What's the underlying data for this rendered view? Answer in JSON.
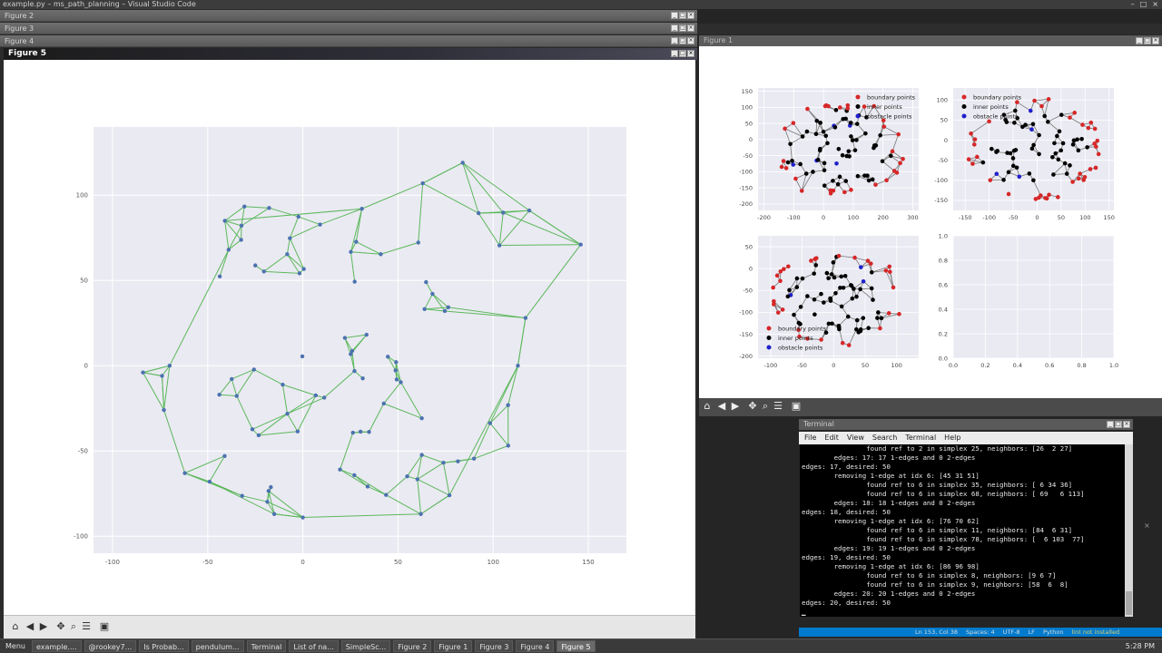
{
  "vscode": {
    "title": "example.py – ms_path_planning – Visual Studio Code",
    "status": {
      "position": "Ln 153, Col 38",
      "spaces": "Spaces: 4",
      "encoding": "UTF-8",
      "eol": "LF",
      "language": "Python",
      "lint": "lint not installed"
    }
  },
  "figures_stack": [
    "Figure 2",
    "Figure 3",
    "Figure 4"
  ],
  "figure5": {
    "title": "Figure 5",
    "chart_data": {
      "type": "scatter",
      "x_ticks": [
        "-100",
        "-50",
        "0",
        "50",
        "100",
        "150"
      ],
      "y_ticks": [
        "100",
        "50",
        "0",
        "-50",
        "-100"
      ],
      "xlim": [
        -110,
        170
      ],
      "ylim": [
        -110,
        140
      ],
      "grid": true,
      "colors": {
        "edge": "#5cb85c",
        "node": "#4c72b0",
        "bg": "#eaeaf2"
      }
    }
  },
  "figure1": {
    "title": "Figure 1",
    "legend": [
      "boundary points",
      "inner points",
      "obstacle points"
    ],
    "subplots": [
      {
        "x_ticks": [
          "-200",
          "-100",
          "0",
          "100",
          "200",
          "300"
        ],
        "y_ticks": [
          "150",
          "100",
          "50",
          "0",
          "-50",
          "-100",
          "-150",
          "-200"
        ]
      },
      {
        "x_ticks": [
          "-150",
          "-100",
          "-50",
          "0",
          "50",
          "100",
          "150"
        ],
        "y_ticks": [
          "100",
          "50",
          "0",
          "-50",
          "-100",
          "-150"
        ]
      },
      {
        "x_ticks": [
          "-100",
          "-50",
          "0",
          "50",
          "100"
        ],
        "y_ticks": [
          "50",
          "0",
          "-50",
          "-100",
          "-150",
          "-200"
        ]
      },
      {
        "x_ticks": [
          "0.0",
          "0.2",
          "0.4",
          "0.6",
          "0.8",
          "1.0"
        ],
        "y_ticks": [
          "1.0",
          "0.8",
          "0.6",
          "0.4",
          "0.2",
          "0.0"
        ]
      }
    ],
    "colors": {
      "boundary": "#d62728",
      "inner": "#000000",
      "obstacle": "#1f1fcc",
      "edge": "#777777"
    }
  },
  "terminal": {
    "title": "Terminal",
    "menu": [
      "File",
      "Edit",
      "View",
      "Search",
      "Terminal",
      "Help"
    ],
    "lines": [
      "                found ref to 2 in simplex 25, neighbors: [26  2 27]",
      "        edges: 17: 17 1-edges and 0 2-edges",
      "edges: 17, desired: 50",
      "        removing 1-edge at idx 6: [45 31 51]",
      "                found ref to 6 in simplex 35, neighbors: [ 6 34 36]",
      "                found ref to 6 in simplex 68, neighbors: [ 69   6 113]",
      "        edges: 18: 18 1-edges and 0 2-edges",
      "edges: 18, desired: 50",
      "        removing 1-edge at idx 6: [76 70 62]",
      "                found ref to 6 in simplex 11, neighbors: [84  6 31]",
      "                found ref to 6 in simplex 78, neighbors: [  6 103  77]",
      "        edges: 19: 19 1-edges and 0 2-edges",
      "edges: 19, desired: 50",
      "        removing 1-edge at idx 6: [86 96 98]",
      "                found ref to 6 in simplex 8, neighbors: [9 6 7]",
      "                found ref to 6 in simplex 9, neighbors: [58  6  8]",
      "        edges: 20: 20 1-edges and 0 2-edges",
      "edges: 20, desired: 50"
    ]
  },
  "taskbar": {
    "menu_label": "Menu",
    "items": [
      "example....",
      "@rookey7...",
      "Is Probab...",
      "pendulum...",
      "Terminal",
      "List of na...",
      "SimpleSc...",
      "Figure 2",
      "Figure 1",
      "Figure 3",
      "Figure 4",
      "Figure 5"
    ],
    "active_index": 11,
    "clock": "5:28 PM"
  }
}
